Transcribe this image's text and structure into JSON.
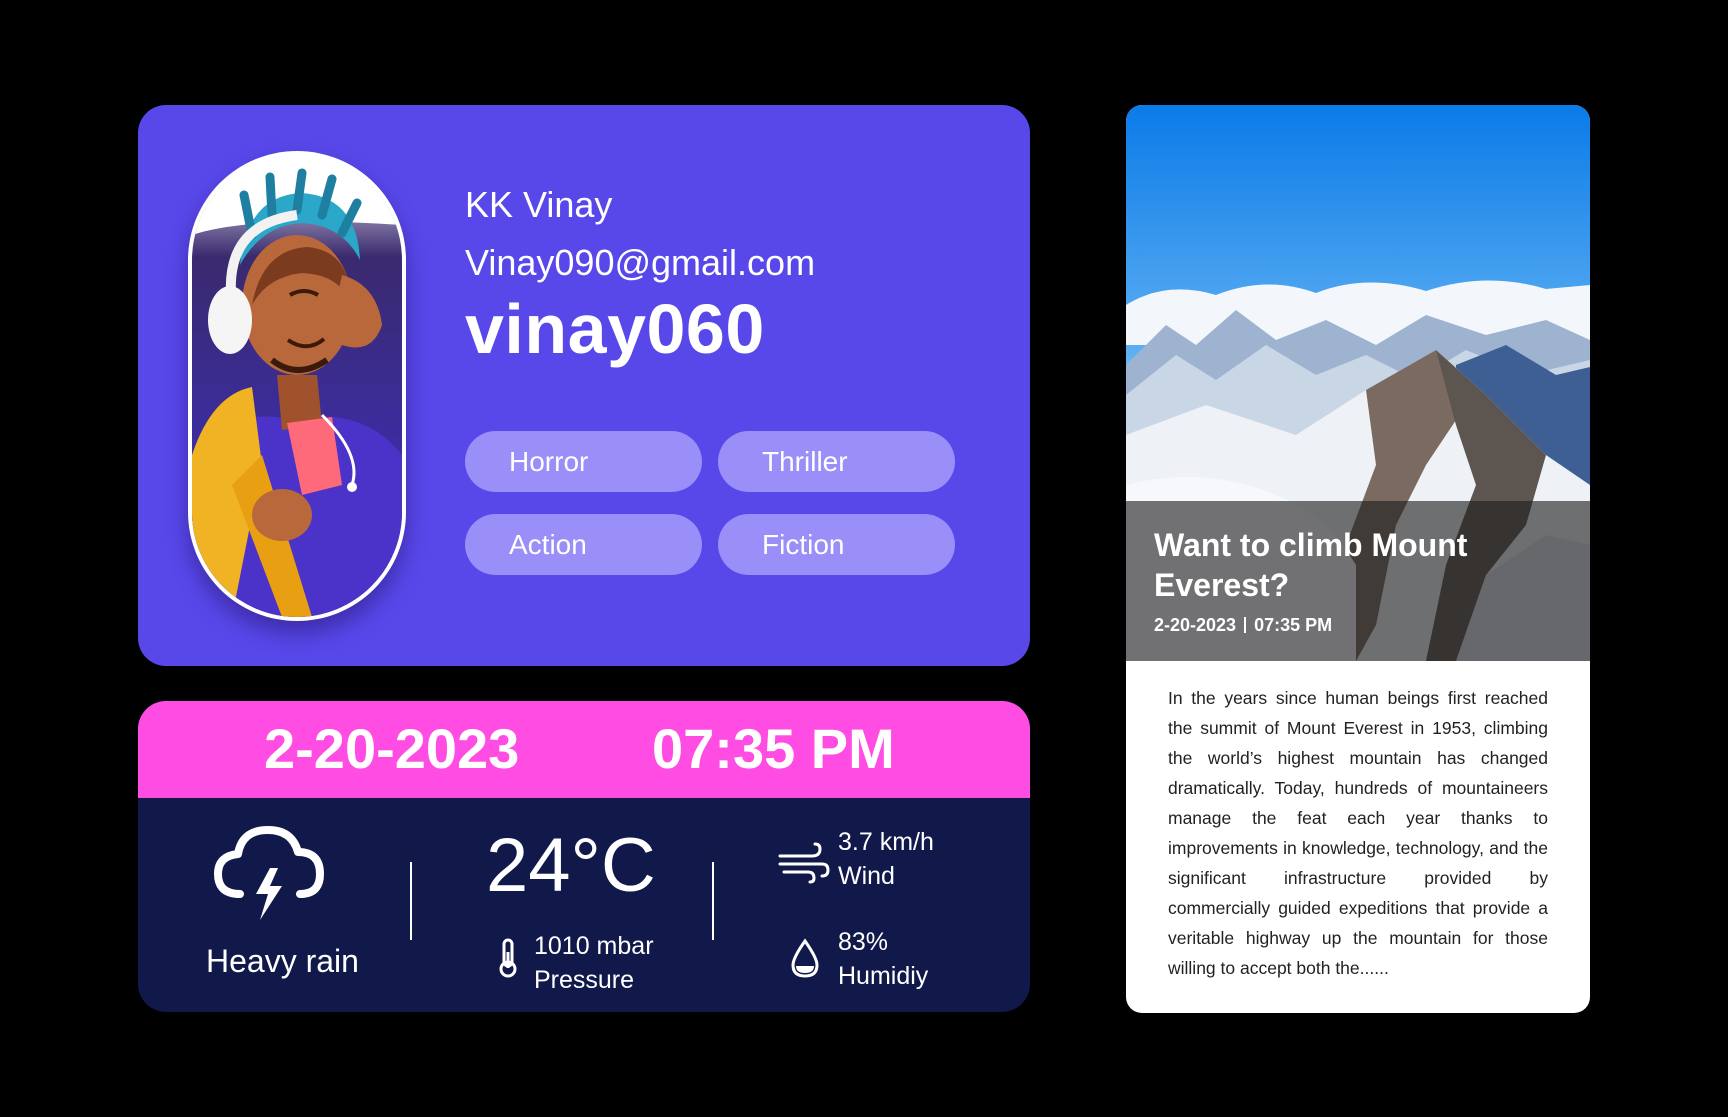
{
  "profile": {
    "name": "KK Vinay",
    "email": "Vinay090@gmail.com",
    "username": "vinay060",
    "avatar_icon": "avatar-illustration",
    "genres": [
      "Horror",
      "Thriller",
      "Action",
      "Fiction"
    ],
    "colors": {
      "card": "#5848EA",
      "chip": "#9A8EF8"
    }
  },
  "weather": {
    "date": "2-20-2023",
    "time": "07:35 PM",
    "condition": "Heavy rain",
    "condition_icon": "cloud-lightning-icon",
    "temperature": "24°C",
    "pressure_value": "1010 mbar",
    "pressure_label": "Pressure",
    "wind_value": "3.7 km/h",
    "wind_label": "Wind",
    "humidity_value": "83%",
    "humidity_label": "Humidiy",
    "colors": {
      "header": "#FF4CE3",
      "body": "#11184A"
    }
  },
  "article": {
    "title": "Want to climb Mount Everest?",
    "date": "2-20-2023",
    "time": "07:35 PM",
    "body": "In the years since human beings first reached the summit of Mount Everest in 1953, climbing the world’s highest mountain has changed dramatically. Today, hundreds of mountaineers manage the feat each year thanks to improvements in knowledge, technology, and the significant infrastructure provided by commercially guided expeditions that provide a veritable highway up the mountain for those willing to accept both the......"
  }
}
